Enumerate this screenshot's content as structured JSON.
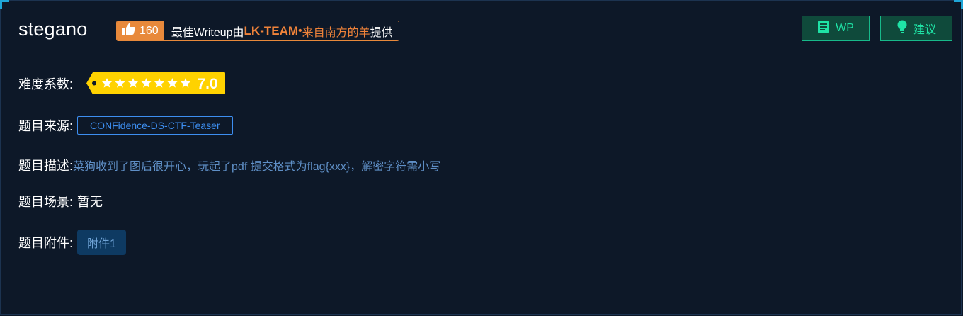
{
  "challenge": {
    "title": "stegano"
  },
  "writeup_badge": {
    "like_count": "160",
    "text_prefix": "最佳Writeup由",
    "team": "LK-TEAM",
    "separator": " • ",
    "author": "来自南方的羊",
    "text_suffix": "提供"
  },
  "buttons": {
    "wp_label": "WP",
    "suggest_label": "建议"
  },
  "details": {
    "difficulty_label": "难度系数:",
    "difficulty_value": "7.0",
    "difficulty_stars": 7,
    "source_label": "题目来源:",
    "source_value": "CONFidence-DS-CTF-Teaser",
    "description_label": "题目描述:",
    "description_value": "菜狗收到了图后很开心，玩起了pdf 提交格式为flag{xxx}，解密字符需小写",
    "scene_label": "题目场景:",
    "scene_value": "暂无",
    "attachment_label": "题目附件:",
    "attachment_value": "附件1"
  },
  "colors": {
    "background": "#0d1828",
    "accent_orange": "#e8893b",
    "rating_yellow": "#ffd200",
    "tag_blue": "#3d8ef0",
    "button_green": "#1fe3a6"
  },
  "icons": {
    "like": "thumbs-up-icon",
    "wp": "document-icon",
    "suggest": "lightbulb-icon",
    "rating": "star-icon"
  }
}
